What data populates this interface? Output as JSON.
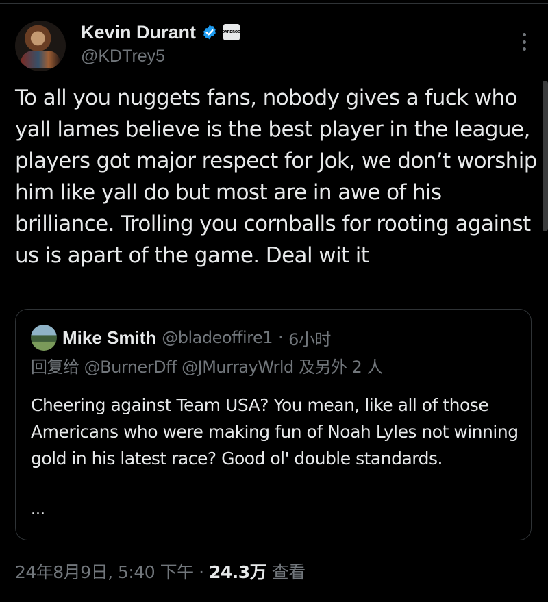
{
  "author": {
    "display_name": "Kevin Durant",
    "handle": "@KDTrey5",
    "affiliate_badge_text": "BOARDROOM"
  },
  "tweet": {
    "text": "To all you nuggets fans, nobody gives a fuck who yall lames believe is the best player in the league, players got major respect for Jok, we don’t worship him like yall do but most are in awe of his brilliance. Trolling you cornballs for rooting against us is apart of the game. Deal wit it"
  },
  "quote": {
    "display_name": "Mike Smith",
    "handle": "@bladeoffire1",
    "separator": "·",
    "time": "6小时",
    "reply_prefix": "回复给",
    "reply_mentions": [
      "@BurnerDff",
      "@JMurrayWrld"
    ],
    "reply_suffix": "及另外 2 人",
    "text": "Cheering against Team USA? You mean, like all of those Americans who were making fun of Noah Lyles not winning gold in his latest race? Good ol' double standards.",
    "ellipsis": "..."
  },
  "footer": {
    "timestamp": "24年8月9日, 5:40 下午",
    "separator": "·",
    "views_count": "24.3万",
    "views_label": "查看"
  },
  "colors": {
    "background": "#000000",
    "text": "#e7e9ea",
    "secondary": "#71767b",
    "verified": "#1d9bf0",
    "border": "#2f3336"
  },
  "icons": {
    "verified": "verified-badge-icon",
    "more": "more-options-icon"
  }
}
